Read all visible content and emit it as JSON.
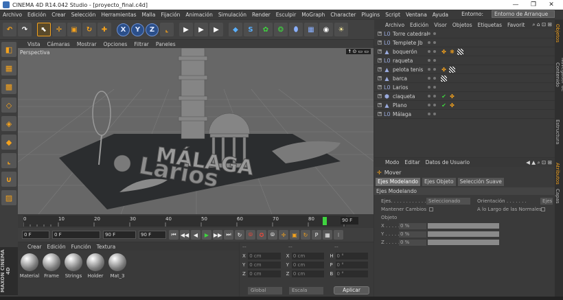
{
  "window": {
    "title": "CINEMA 4D R14.042 Studio - [proyecto_final.c4d]",
    "minimize": "—",
    "restore": "❐",
    "close": "✕"
  },
  "menu": [
    "Archivo",
    "Edición",
    "Crear",
    "Selección",
    "Herramientas",
    "Malla",
    "Fijación",
    "Animación",
    "Simulación",
    "Render",
    "Esculpir",
    "MoGraph",
    "Character",
    "Plugins",
    "Script",
    "Ventana",
    "Ayuda"
  ],
  "entorno": {
    "label": "Entorno:",
    "value": "Entorno de Arranque"
  },
  "toolbar": {
    "undo": "↶",
    "redo": "↷",
    "select": "⬉",
    "move": "✛",
    "scale": "▣",
    "rotate": "↻",
    "axis": "✚",
    "x": "X",
    "y": "Y",
    "z": "Z",
    "world": "⌞",
    "render1": "▶",
    "render2": "▶",
    "render3": "▶",
    "cube": "◆",
    "spline": "S",
    "nurbs": "✿",
    "array": "❂",
    "deformer": "⬮",
    "scene": "▦",
    "camera": "◉",
    "light": "☀"
  },
  "leftTools": [
    "◧",
    "▦",
    "▩",
    "◇",
    "◈",
    "◆",
    "⌞",
    "∪",
    "▨"
  ],
  "viewport": {
    "menu": [
      "Vista",
      "Cámaras",
      "Mostrar",
      "Opciones",
      "Filtrar",
      "Paneles"
    ],
    "label": "Perspectiva",
    "corner": "☨ ⊙ ▭ ▭"
  },
  "timeline": {
    "labels": [
      "0",
      "10",
      "20",
      "30",
      "40",
      "50",
      "60",
      "70",
      "80",
      "90"
    ],
    "frame": "90 F",
    "progress": 0.94
  },
  "playbar": {
    "start": "0 F",
    "current": "0 F",
    "end": "90 F",
    "end2": "90 F",
    "buttons": [
      "⏮",
      "◀◀",
      "◀",
      "▶",
      "▶▶",
      "⏭",
      "↻",
      "⦾",
      "✪",
      "⦾",
      "✛",
      "▣",
      "↻",
      "P",
      "▦",
      "⁝"
    ]
  },
  "materials": {
    "menu": [
      "Crear",
      "Edición",
      "Función",
      "Textura"
    ],
    "items": [
      "Material",
      "Frame",
      "Strings",
      "Holder",
      "Mat_3"
    ]
  },
  "maxon": "MAXON CINEMA 4D",
  "coords": {
    "headers": [
      "--",
      "--",
      "--"
    ],
    "rows": [
      {
        "a": "X",
        "v1": "0 cm",
        "b": "X",
        "v2": "0 cm",
        "c": "H",
        "v3": "0 °"
      },
      {
        "a": "Y",
        "v1": "0 cm",
        "b": "Y",
        "v2": "0 cm",
        "c": "P",
        "v3": "0 °"
      },
      {
        "a": "Z",
        "v1": "0 cm",
        "b": "Z",
        "v2": "0 cm",
        "c": "B",
        "v3": "0 °"
      }
    ],
    "system": "Global",
    "scale": "Escala",
    "apply": "Aplicar"
  },
  "objects": {
    "menu": [
      "Archivo",
      "Edición",
      "Visor",
      "Objetos",
      "Etiquetas",
      "Favorit"
    ],
    "items": [
      {
        "name": "Torre catedral",
        "icon": "L0",
        "tags": []
      },
      {
        "name": "Templete Jb",
        "icon": "L0",
        "tags": []
      },
      {
        "name": "boquerón",
        "icon": "▲",
        "tags": [
          "✤",
          "❋",
          "chk"
        ]
      },
      {
        "name": "raqueta",
        "icon": "L0",
        "tags": []
      },
      {
        "name": "pelota tenis",
        "icon": "▲",
        "tags": [
          "✤",
          "chk"
        ]
      },
      {
        "name": "barca",
        "icon": "▲",
        "tags": [
          "chk"
        ]
      },
      {
        "name": "Larios",
        "icon": "L0",
        "tags": []
      },
      {
        "name": "claqueta",
        "icon": "⬢",
        "tags": [
          "✔",
          "✤"
        ]
      },
      {
        "name": "Plano",
        "icon": "▲",
        "tags": [
          "✔",
          "✤"
        ]
      },
      {
        "name": "Málaga",
        "icon": "L0",
        "tags": []
      }
    ]
  },
  "attributes": {
    "menu": [
      "Modo",
      "Editar",
      "Datos de Usuario"
    ],
    "title": "Mover",
    "tabs": [
      "Ejes Modelando",
      "Ejes Objeto",
      "Selección Suave"
    ],
    "section": "Ejes Modelando",
    "ejes": "Ejes. . . . . . . . . . . .",
    "ejesValue": "Seleccionado",
    "orientacion": "Orientación . . . . . . .",
    "orientacionValue": "Ejes",
    "mantener": "Mantener Cambios",
    "largo": "A lo Largo de las Normales",
    "objeto": "Objeto",
    "x": "X . . . . .",
    "y": "Y . . . . .",
    "z": "Z . . . . .",
    "pct": "0 %"
  },
  "sideTabs": [
    "Objetos",
    "Navegador de Contenido",
    "Estructura",
    "Atributos",
    "Capas"
  ]
}
